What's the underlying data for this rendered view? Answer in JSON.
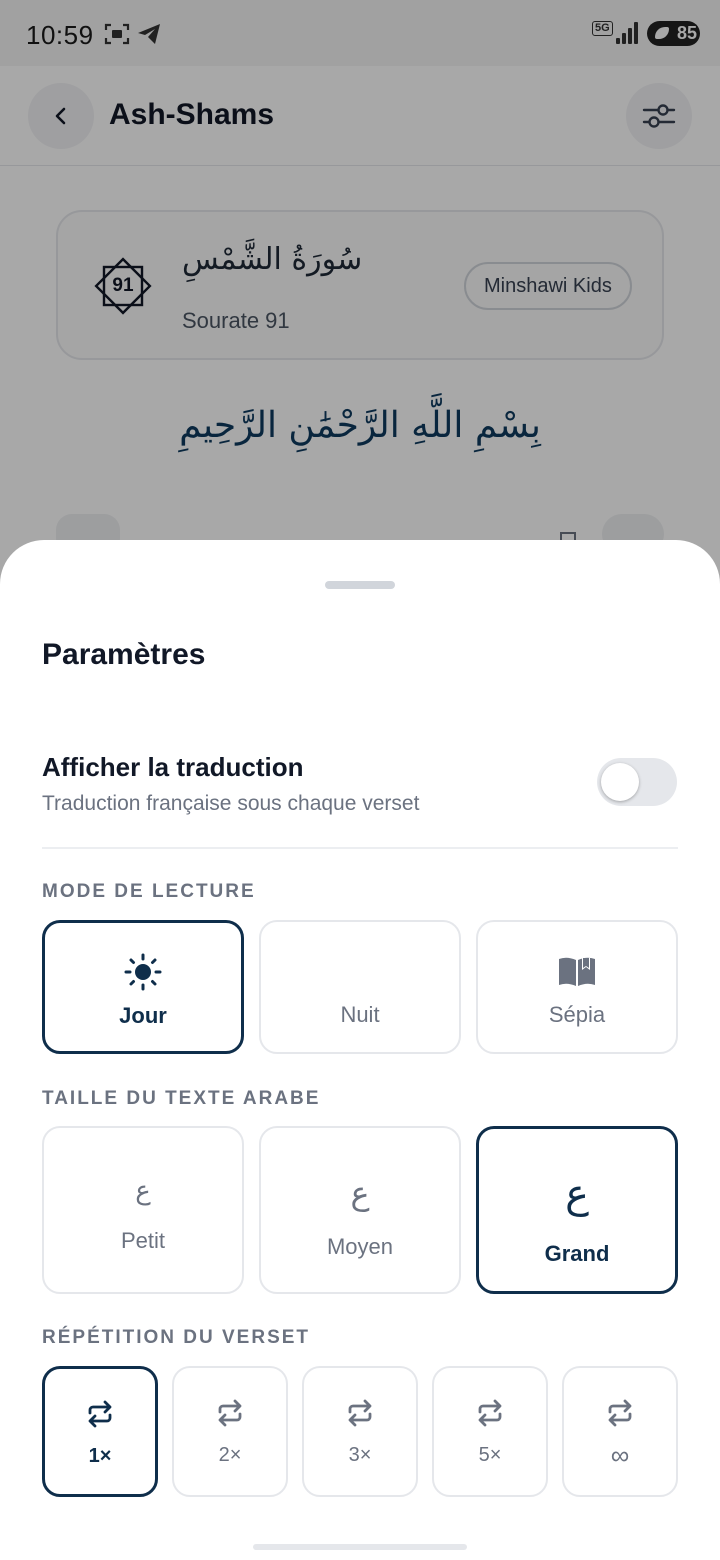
{
  "status": {
    "time": "10:59",
    "network": "5G",
    "battery": "85"
  },
  "header": {
    "title": "Ash-Shams"
  },
  "surah": {
    "number": "91",
    "arabic_name": "سُورَةُ الشَّمْسِ",
    "subtitle": "Sourate 91",
    "reciter": "Minshawi Kids",
    "basmala": "بِسْمِ اللَّهِ الرَّحْمَٰنِ الرَّحِيمِ"
  },
  "sheet": {
    "title": "Paramètres",
    "translation": {
      "title": "Afficher la traduction",
      "subtitle": "Traduction française sous chaque verset",
      "enabled": false
    },
    "reading_mode": {
      "label": "MODE DE LECTURE",
      "options": [
        {
          "label": "Jour",
          "icon": "sun-icon",
          "selected": true
        },
        {
          "label": "Nuit",
          "icon": "moon-icon",
          "selected": false
        },
        {
          "label": "Sépia",
          "icon": "book-icon",
          "selected": false
        }
      ]
    },
    "text_size": {
      "label": "TAILLE DU TEXTE ARABE",
      "glyph": "ع",
      "options": [
        {
          "label": "Petit",
          "selected": false
        },
        {
          "label": "Moyen",
          "selected": false
        },
        {
          "label": "Grand",
          "selected": true
        }
      ]
    },
    "repeat": {
      "label": "RÉPÉTITION DU VERSET",
      "options": [
        {
          "label": "1×",
          "selected": true
        },
        {
          "label": "2×",
          "selected": false
        },
        {
          "label": "3×",
          "selected": false
        },
        {
          "label": "5×",
          "selected": false
        },
        {
          "label": "∞",
          "selected": false
        }
      ]
    }
  },
  "colors": {
    "accent": "#0f2e4b",
    "muted": "#6b7280",
    "border": "#e5e7eb"
  }
}
